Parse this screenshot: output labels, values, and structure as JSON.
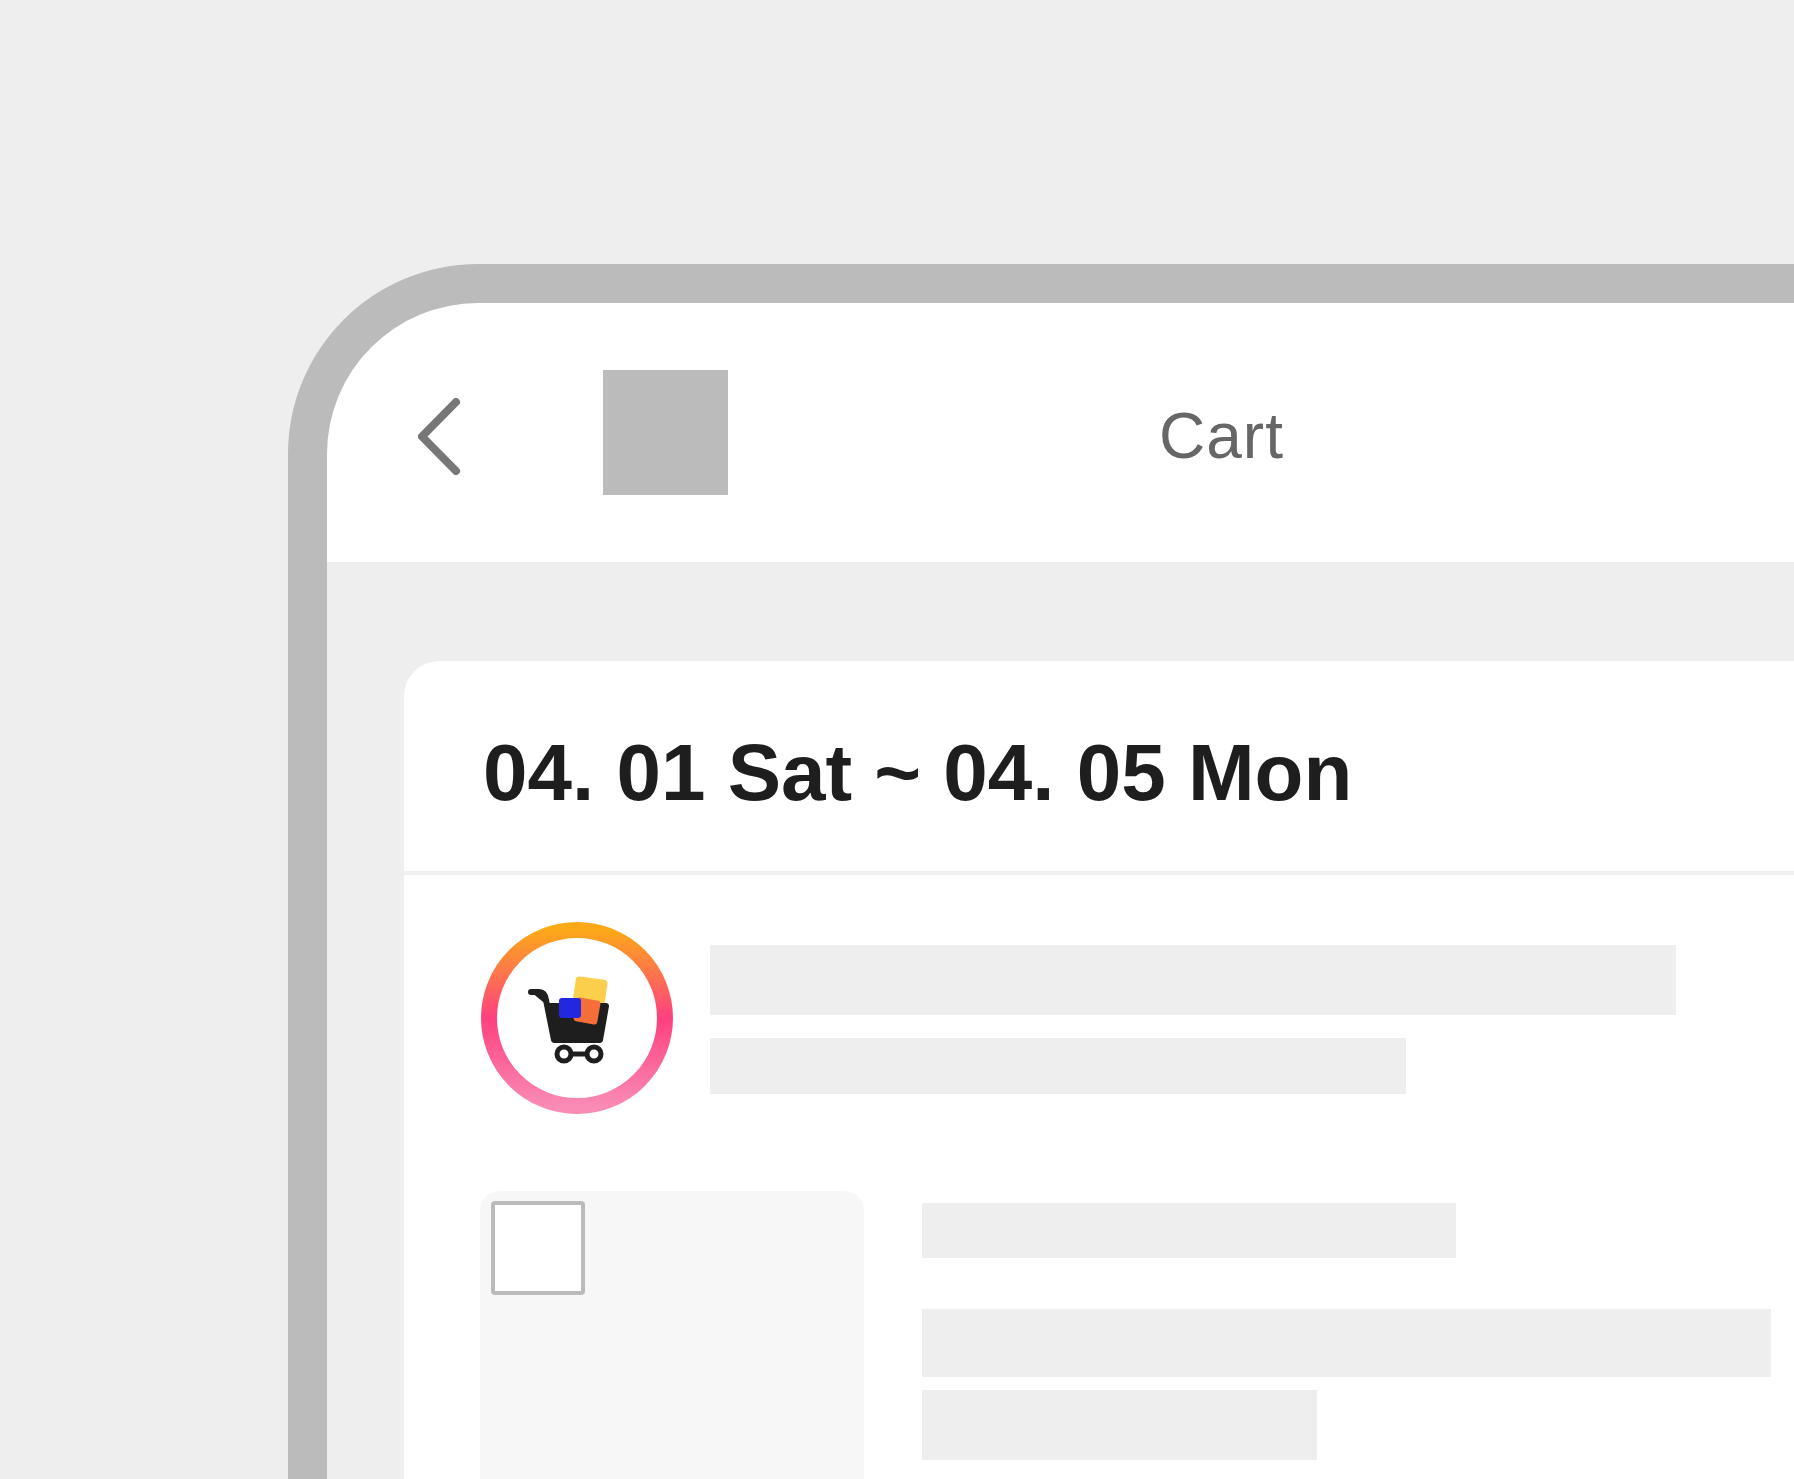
{
  "header": {
    "title": "Cart"
  },
  "booking": {
    "dates": "04. 01 Sat ~ 04. 05 Mon"
  },
  "items": [
    {
      "checked": false
    }
  ]
}
